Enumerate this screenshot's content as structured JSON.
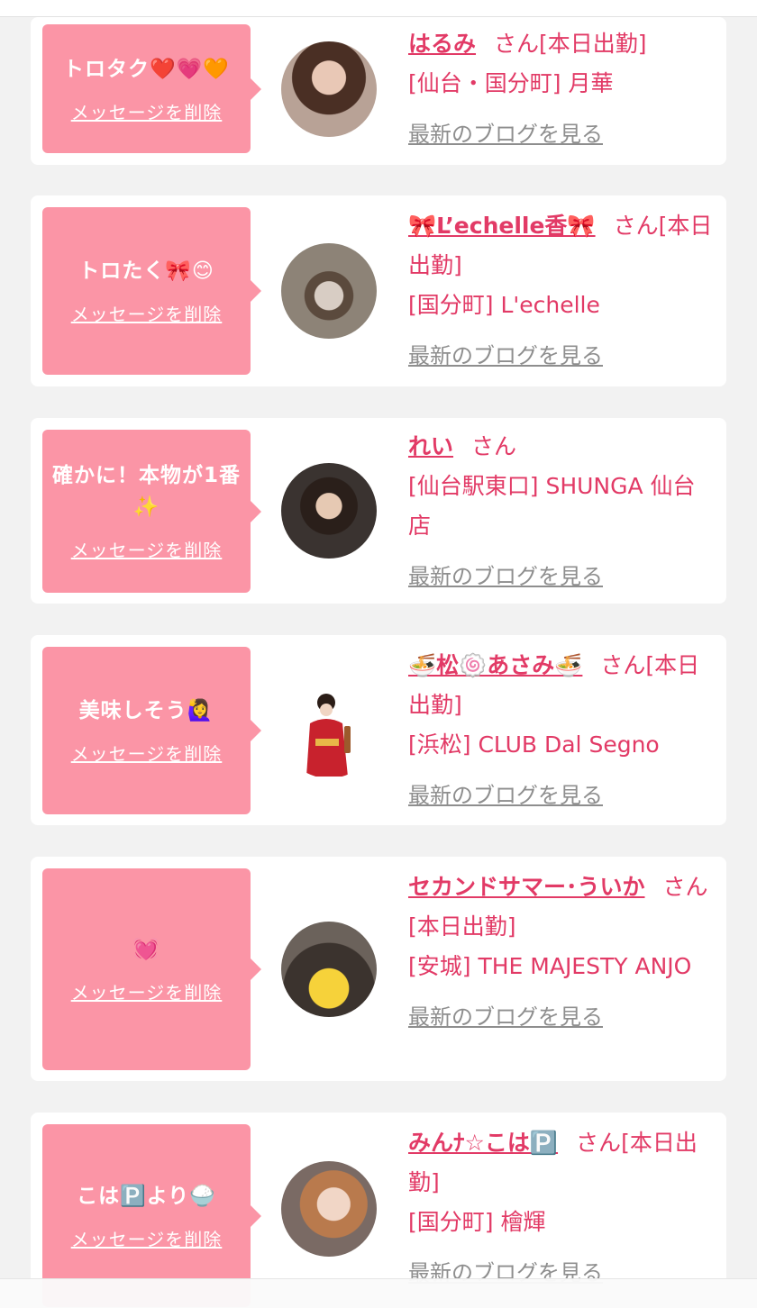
{
  "delete_label": "メッセージを削除",
  "blog_label": "最新のブログを見る",
  "san_label": "さん",
  "cards": [
    {
      "message": "トロタク❤️💗🧡",
      "name": "はるみ",
      "status": "[本日出勤]",
      "shop": "[仙台・国分町] 月華",
      "avatar_icon": "avatar-photo-1"
    },
    {
      "message": "トロたく🎀😊",
      "name": "🎀L’echelle香🎀",
      "status": "[本日出勤]",
      "shop": "[国分町] L'echelle",
      "avatar_icon": "avatar-photo-2"
    },
    {
      "message": "確かに！本物が1番✨",
      "name": "れい",
      "status": "",
      "shop": "[仙台駅東口] SHUNGA 仙台店",
      "avatar_icon": "avatar-photo-3"
    },
    {
      "message": "美味しそう🙋‍♀️",
      "name": "🍜松🍥あさみ🍜",
      "status": "[本日出勤]",
      "shop": "[浜松] CLUB Dal Segno",
      "avatar_icon": "avatar-photo-4"
    },
    {
      "message": "💓",
      "name": "セカンドサマー･ういか",
      "status": "[本日出勤]",
      "shop": "[安城] THE MAJESTY ANJO",
      "avatar_icon": "avatar-photo-5"
    },
    {
      "message": "こは🅿️より🍚",
      "name": "みんﾅ☆こは🅿️",
      "status": "[本日出勤]",
      "shop": "[国分町] 檜輝",
      "avatar_icon": "avatar-photo-6"
    }
  ]
}
